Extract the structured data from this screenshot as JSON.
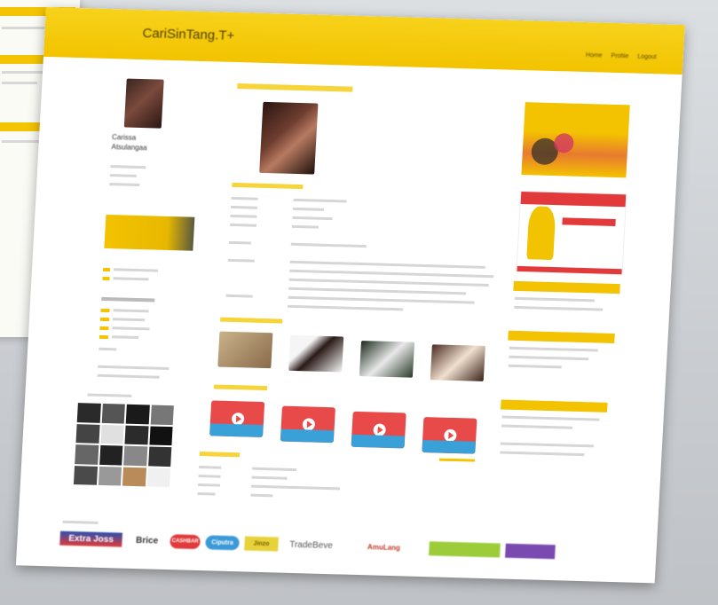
{
  "site": {
    "title": "CariSinTang.T+"
  },
  "nav": {
    "items": [
      "Home",
      "Profile",
      "Logout"
    ]
  },
  "colors": {
    "brand": "#f4c400",
    "brand_dark": "#e0a800",
    "video": "#e84a4a"
  },
  "profile": {
    "name_line1": "Carissa",
    "name_line2": "Atsulangaa"
  },
  "partner_logos": [
    "Extra Joss",
    "Brice",
    "CASHBAR",
    "Ciputra",
    "Jinzo",
    "TradeBeve",
    "AmuLang",
    "",
    ""
  ]
}
